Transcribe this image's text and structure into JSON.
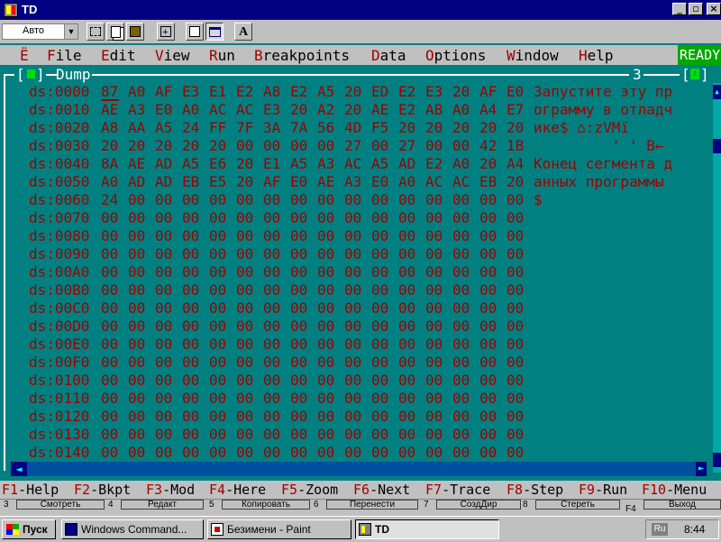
{
  "window": {
    "title": "TD",
    "min_glyph": "_",
    "max_glyph": "▫",
    "close_glyph": "×"
  },
  "toolbar": {
    "font_size_value": "Авто",
    "font_button_label": "A"
  },
  "menu": {
    "system_label": "Ë",
    "items": [
      {
        "hk": "F",
        "rest": "ile"
      },
      {
        "hk": "E",
        "rest": "dit"
      },
      {
        "hk": "V",
        "rest": "iew"
      },
      {
        "hk": "R",
        "rest": "un"
      },
      {
        "hk": "B",
        "rest": "reakpoints"
      },
      {
        "hk": "D",
        "rest": "ata"
      },
      {
        "hk": "O",
        "rest": "ptions"
      },
      {
        "hk": "W",
        "rest": "indow"
      },
      {
        "hk": "H",
        "rest": "elp"
      }
    ],
    "status": "READY"
  },
  "dump_window": {
    "title": "Dump",
    "window_number": "3",
    "zoom_glyph": "↕",
    "rows": [
      {
        "addr": "ds:0000",
        "bytes": [
          "87",
          "A0",
          "AF",
          "E3",
          "E1",
          "E2",
          "A8",
          "E2",
          "A5",
          "20",
          "ED",
          "E2",
          "E3",
          "20",
          "AF",
          "E0"
        ],
        "ascii": "Запустите эту пр"
      },
      {
        "addr": "ds:0010",
        "bytes": [
          "AE",
          "A3",
          "E0",
          "A0",
          "AC",
          "AC",
          "E3",
          "20",
          "A2",
          "20",
          "AE",
          "E2",
          "AB",
          "A0",
          "A4",
          "E7"
        ],
        "ascii": "ограмму в отладч"
      },
      {
        "addr": "ds:0020",
        "bytes": [
          "A8",
          "AA",
          "A5",
          "24",
          "FF",
          "7F",
          "3A",
          "7A",
          "56",
          "4D",
          "F5",
          "20",
          "20",
          "20",
          "20",
          "20"
        ],
        "ascii": "ике$ ⌂:zVMї"
      },
      {
        "addr": "ds:0030",
        "bytes": [
          "20",
          "20",
          "20",
          "20",
          "20",
          "00",
          "00",
          "00",
          "00",
          "27",
          "00",
          "27",
          "00",
          "00",
          "42",
          "1B"
        ],
        "ascii": "         ' ' B←"
      },
      {
        "addr": "ds:0040",
        "bytes": [
          "8A",
          "AE",
          "AD",
          "A5",
          "E6",
          "20",
          "E1",
          "A5",
          "A3",
          "AC",
          "A5",
          "AD",
          "E2",
          "A0",
          "20",
          "A4"
        ],
        "ascii": "Конец сегмента д"
      },
      {
        "addr": "ds:0050",
        "bytes": [
          "A0",
          "AD",
          "AD",
          "EB",
          "E5",
          "20",
          "AF",
          "E0",
          "AE",
          "A3",
          "E0",
          "A0",
          "AC",
          "AC",
          "EB",
          "20"
        ],
        "ascii": "анных программы "
      },
      {
        "addr": "ds:0060",
        "bytes": [
          "24",
          "00",
          "00",
          "00",
          "00",
          "00",
          "00",
          "00",
          "00",
          "00",
          "00",
          "00",
          "00",
          "00",
          "00",
          "00"
        ],
        "ascii": "$"
      },
      {
        "addr": "ds:0070",
        "bytes": [
          "00",
          "00",
          "00",
          "00",
          "00",
          "00",
          "00",
          "00",
          "00",
          "00",
          "00",
          "00",
          "00",
          "00",
          "00",
          "00"
        ],
        "ascii": ""
      },
      {
        "addr": "ds:0080",
        "bytes": [
          "00",
          "00",
          "00",
          "00",
          "00",
          "00",
          "00",
          "00",
          "00",
          "00",
          "00",
          "00",
          "00",
          "00",
          "00",
          "00"
        ],
        "ascii": ""
      },
      {
        "addr": "ds:0090",
        "bytes": [
          "00",
          "00",
          "00",
          "00",
          "00",
          "00",
          "00",
          "00",
          "00",
          "00",
          "00",
          "00",
          "00",
          "00",
          "00",
          "00"
        ],
        "ascii": ""
      },
      {
        "addr": "ds:00A0",
        "bytes": [
          "00",
          "00",
          "00",
          "00",
          "00",
          "00",
          "00",
          "00",
          "00",
          "00",
          "00",
          "00",
          "00",
          "00",
          "00",
          "00"
        ],
        "ascii": ""
      },
      {
        "addr": "ds:00B0",
        "bytes": [
          "00",
          "00",
          "00",
          "00",
          "00",
          "00",
          "00",
          "00",
          "00",
          "00",
          "00",
          "00",
          "00",
          "00",
          "00",
          "00"
        ],
        "ascii": ""
      },
      {
        "addr": "ds:00C0",
        "bytes": [
          "00",
          "00",
          "00",
          "00",
          "00",
          "00",
          "00",
          "00",
          "00",
          "00",
          "00",
          "00",
          "00",
          "00",
          "00",
          "00"
        ],
        "ascii": ""
      },
      {
        "addr": "ds:00D0",
        "bytes": [
          "00",
          "00",
          "00",
          "00",
          "00",
          "00",
          "00",
          "00",
          "00",
          "00",
          "00",
          "00",
          "00",
          "00",
          "00",
          "00"
        ],
        "ascii": ""
      },
      {
        "addr": "ds:00E0",
        "bytes": [
          "00",
          "00",
          "00",
          "00",
          "00",
          "00",
          "00",
          "00",
          "00",
          "00",
          "00",
          "00",
          "00",
          "00",
          "00",
          "00"
        ],
        "ascii": ""
      },
      {
        "addr": "ds:00F0",
        "bytes": [
          "00",
          "00",
          "00",
          "00",
          "00",
          "00",
          "00",
          "00",
          "00",
          "00",
          "00",
          "00",
          "00",
          "00",
          "00",
          "00"
        ],
        "ascii": ""
      },
      {
        "addr": "ds:0100",
        "bytes": [
          "00",
          "00",
          "00",
          "00",
          "00",
          "00",
          "00",
          "00",
          "00",
          "00",
          "00",
          "00",
          "00",
          "00",
          "00",
          "00"
        ],
        "ascii": ""
      },
      {
        "addr": "ds:0110",
        "bytes": [
          "00",
          "00",
          "00",
          "00",
          "00",
          "00",
          "00",
          "00",
          "00",
          "00",
          "00",
          "00",
          "00",
          "00",
          "00",
          "00"
        ],
        "ascii": ""
      },
      {
        "addr": "ds:0120",
        "bytes": [
          "00",
          "00",
          "00",
          "00",
          "00",
          "00",
          "00",
          "00",
          "00",
          "00",
          "00",
          "00",
          "00",
          "00",
          "00",
          "00"
        ],
        "ascii": ""
      },
      {
        "addr": "ds:0130",
        "bytes": [
          "00",
          "00",
          "00",
          "00",
          "00",
          "00",
          "00",
          "00",
          "00",
          "00",
          "00",
          "00",
          "00",
          "00",
          "00",
          "00"
        ],
        "ascii": ""
      },
      {
        "addr": "ds:0140",
        "bytes": [
          "00",
          "00",
          "00",
          "00",
          "00",
          "00",
          "00",
          "00",
          "00",
          "00",
          "00",
          "00",
          "00",
          "00",
          "00",
          "00"
        ],
        "ascii": ""
      }
    ]
  },
  "function_keys": [
    {
      "key": "F1",
      "label": "-Help"
    },
    {
      "key": "F2",
      "label": "-Bkpt"
    },
    {
      "key": "F3",
      "label": "-Mod"
    },
    {
      "key": "F4",
      "label": "-Here"
    },
    {
      "key": "F5",
      "label": "-Zoom"
    },
    {
      "key": "F6",
      "label": "-Next"
    },
    {
      "key": "F7",
      "label": "-Trace"
    },
    {
      "key": "F8",
      "label": "-Step"
    },
    {
      "key": "F9",
      "label": "-Run"
    },
    {
      "key": "F10",
      "label": "-Menu"
    }
  ],
  "behind_strip": {
    "items": [
      {
        "num": "3",
        "label": "Смотреть"
      },
      {
        "num": "4",
        "label": "Редакт"
      },
      {
        "num": "5",
        "label": "Копировать"
      },
      {
        "num": "6",
        "label": "Перенести"
      },
      {
        "num": "7",
        "label": "СоздДир"
      },
      {
        "num": "8",
        "label": "Стереть"
      },
      {
        "num": "F4",
        "label": "Выход"
      }
    ]
  },
  "taskbar": {
    "start_label": "Пуск",
    "tasks": [
      {
        "label": "Windows Command..."
      },
      {
        "label": "Безимени - Paint"
      },
      {
        "label": "TD"
      }
    ],
    "lang": "Ru",
    "clock": "8:44"
  }
}
